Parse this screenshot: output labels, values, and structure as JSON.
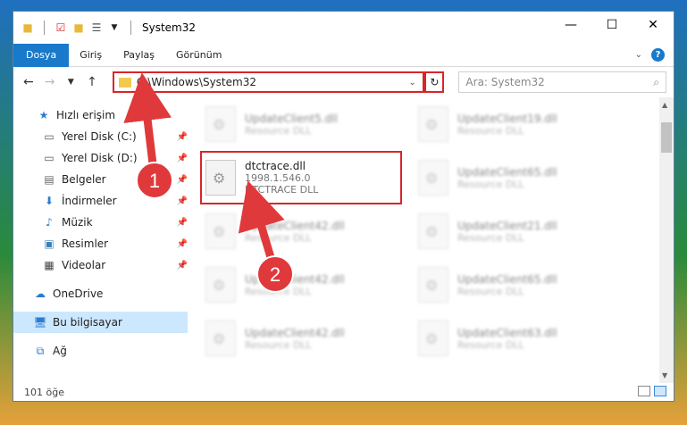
{
  "window": {
    "title": "System32",
    "buttons": {
      "minimize": "—",
      "maximize": "☐",
      "close": "✕"
    }
  },
  "ribbon": {
    "tabs": [
      "Dosya",
      "Giriş",
      "Paylaş",
      "Görünüm"
    ],
    "help": "?"
  },
  "address": {
    "path": "C:\\Windows\\System32",
    "search_placeholder": "Ara: System32"
  },
  "nav": {
    "items": [
      {
        "label": "Hızlı erişim",
        "icon": "star-icon"
      },
      {
        "label": "Yerel Disk (C:)",
        "icon": "drive-icon"
      },
      {
        "label": "Yerel Disk (D:)",
        "icon": "drive-icon"
      },
      {
        "label": "Belgeler",
        "icon": "documents-icon"
      },
      {
        "label": "İndirmeler",
        "icon": "download-icon"
      },
      {
        "label": "Müzik",
        "icon": "music-icon"
      },
      {
        "label": "Resimler",
        "icon": "pictures-icon"
      },
      {
        "label": "Videolar",
        "icon": "video-icon"
      },
      {
        "label": "OneDrive",
        "icon": "cloud-icon"
      },
      {
        "label": "Bu bilgisayar",
        "icon": "computer-icon"
      },
      {
        "label": "Ağ",
        "icon": "network-icon"
      }
    ]
  },
  "files": {
    "col1": [
      {
        "name": "UpdateClient5.dll",
        "sub": "Resource DLL"
      },
      {
        "name": "dtctrace.dll",
        "version": "1998.1.546.0",
        "desc": "DTCTRACE DLL"
      },
      {
        "name": "UpdateClient42.dll",
        "sub": "Resource DLL"
      },
      {
        "name": "UpdateClient42.dll",
        "sub": "Resource DLL"
      },
      {
        "name": "UpdateClient42.dll",
        "sub": "Resource DLL"
      }
    ],
    "col2": [
      {
        "name": "UpdateClient19.dll",
        "sub": "Resource DLL"
      },
      {
        "name": "UpdateClient65.dll",
        "sub": "Resource DLL"
      },
      {
        "name": "UpdateClient21.dll",
        "sub": "Resource DLL"
      },
      {
        "name": "UpdateClient65.dll",
        "sub": "Resource DLL"
      },
      {
        "name": "UpdateClient63.dll",
        "sub": "Resource DLL"
      }
    ]
  },
  "status": {
    "count": "101 öğe"
  },
  "annotations": {
    "step1": "1",
    "step2": "2"
  },
  "colors": {
    "accent": "#1979ca",
    "highlight": "#d9252a"
  }
}
